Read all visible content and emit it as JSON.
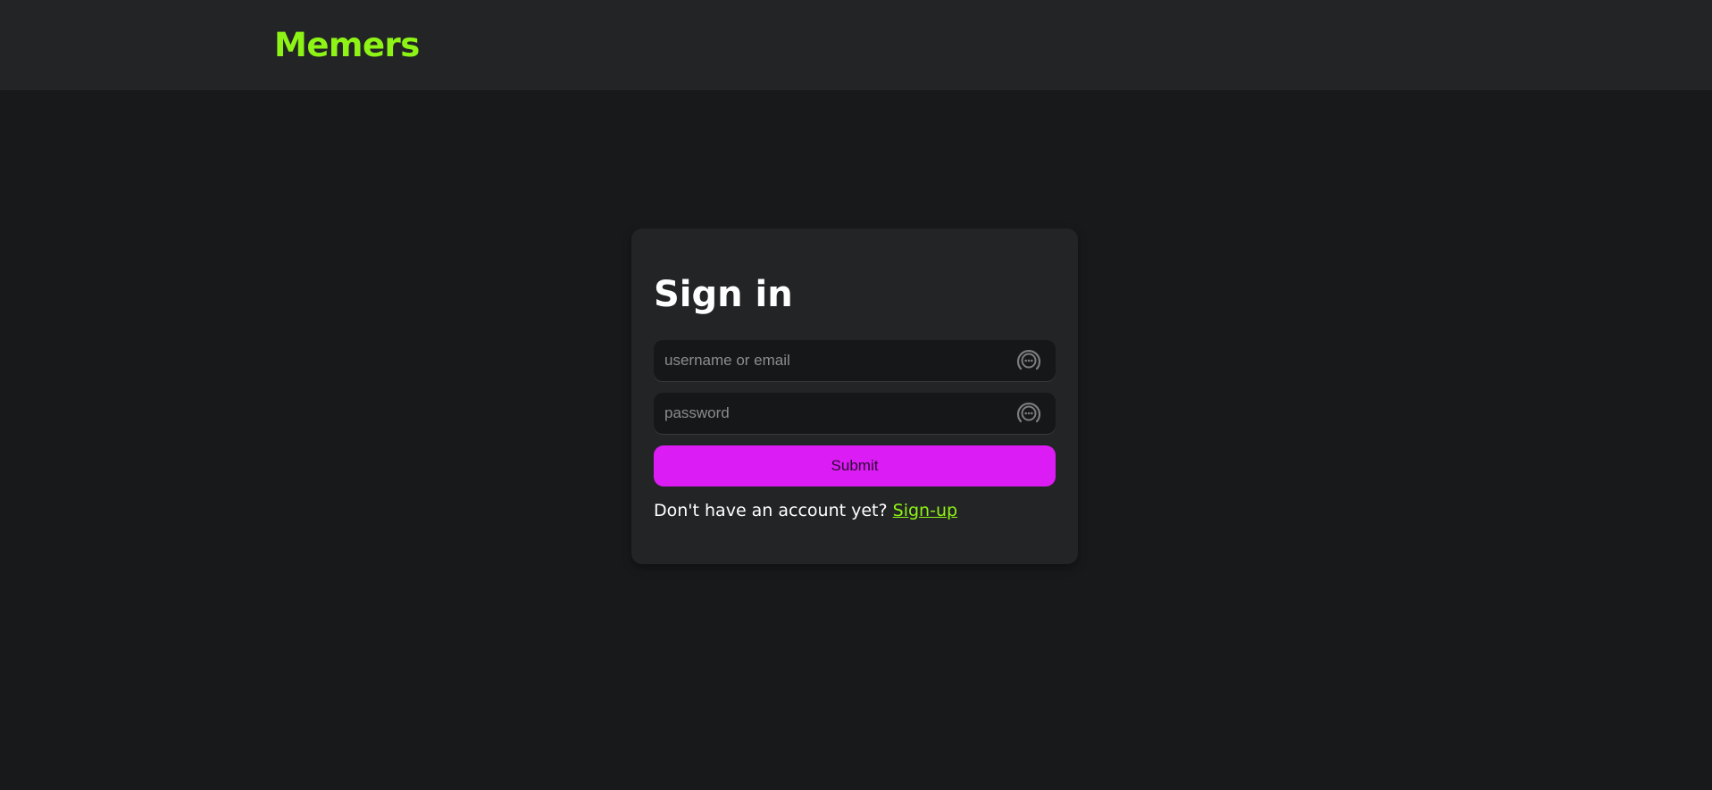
{
  "header": {
    "brand": "Memers"
  },
  "signin": {
    "title": "Sign in",
    "username_placeholder": "username or email",
    "username_value": "",
    "password_placeholder": "password",
    "password_value": "",
    "submit_label": "Submit",
    "no_account_text": "Don't have an account yet?",
    "signup_link": "Sign-up"
  },
  "icons": {
    "field_icon": "password-manager-icon"
  },
  "colors": {
    "brand": "#8ef415",
    "accent": "#dc1cf4",
    "page_bg": "#18191b",
    "panel_bg": "#232426",
    "input_bg": "#161719"
  }
}
